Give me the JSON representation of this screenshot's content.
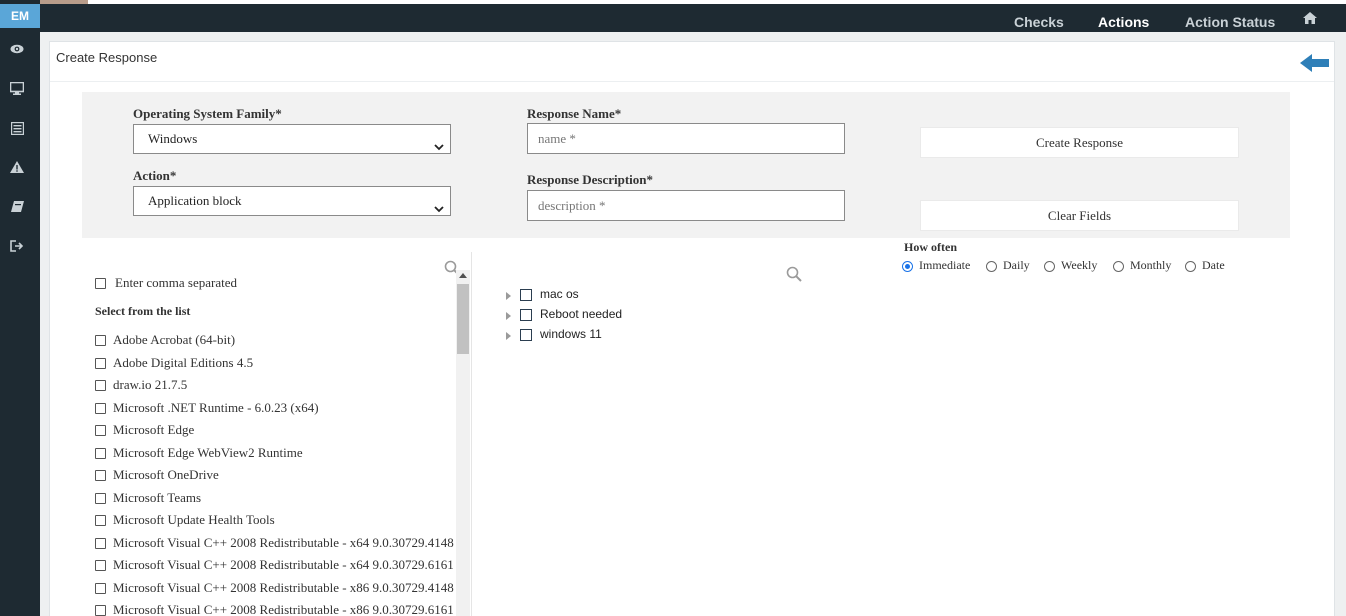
{
  "brand": "EM",
  "topnav": [
    {
      "label": "Checks",
      "active": false
    },
    {
      "label": "Actions",
      "active": true
    },
    {
      "label": "Action Status",
      "active": false
    }
  ],
  "sidebar_icons": [
    "eye-icon",
    "monitor-icon",
    "list-icon",
    "warning-icon",
    "book-icon",
    "logout-icon"
  ],
  "card": {
    "title": "Create Response"
  },
  "form": {
    "os_label": "Operating System Family*",
    "os_value": "Windows",
    "action_label": "Action*",
    "action_value": "Application block",
    "name_label": "Response Name*",
    "name_placeholder": "name *",
    "desc_label": "Response Description*",
    "desc_placeholder": "description *",
    "create_button": "Create Response",
    "clear_button": "Clear Fields"
  },
  "left_list": {
    "comma_label": "Enter comma separated",
    "select_title": "Select from the list",
    "items": [
      "Adobe Acrobat (64-bit)",
      "Adobe Digital Editions 4.5",
      "draw.io 21.7.5",
      "Microsoft .NET Runtime - 6.0.23 (x64)",
      "Microsoft Edge",
      "Microsoft Edge WebView2 Runtime",
      "Microsoft OneDrive",
      "Microsoft Teams",
      "Microsoft Update Health Tools",
      "Microsoft Visual C++ 2008 Redistributable - x64 9.0.30729.4148",
      "Microsoft Visual C++ 2008 Redistributable - x64 9.0.30729.6161",
      "Microsoft Visual C++ 2008 Redistributable - x86 9.0.30729.4148",
      "Microsoft Visual C++ 2008 Redistributable - x86 9.0.30729.6161"
    ]
  },
  "tree": {
    "items": [
      "mac os",
      "Reboot needed",
      "windows 11"
    ]
  },
  "how_often": {
    "label": "How often",
    "options": [
      "Immediate",
      "Daily",
      "Weekly",
      "Monthly",
      "Date"
    ],
    "selected": "Immediate"
  },
  "colors": {
    "accent": "#1a73e8",
    "brand": "#5aa6d8",
    "nav_bg": "#1e2a32",
    "back_arrow": "#2e7fb8"
  }
}
